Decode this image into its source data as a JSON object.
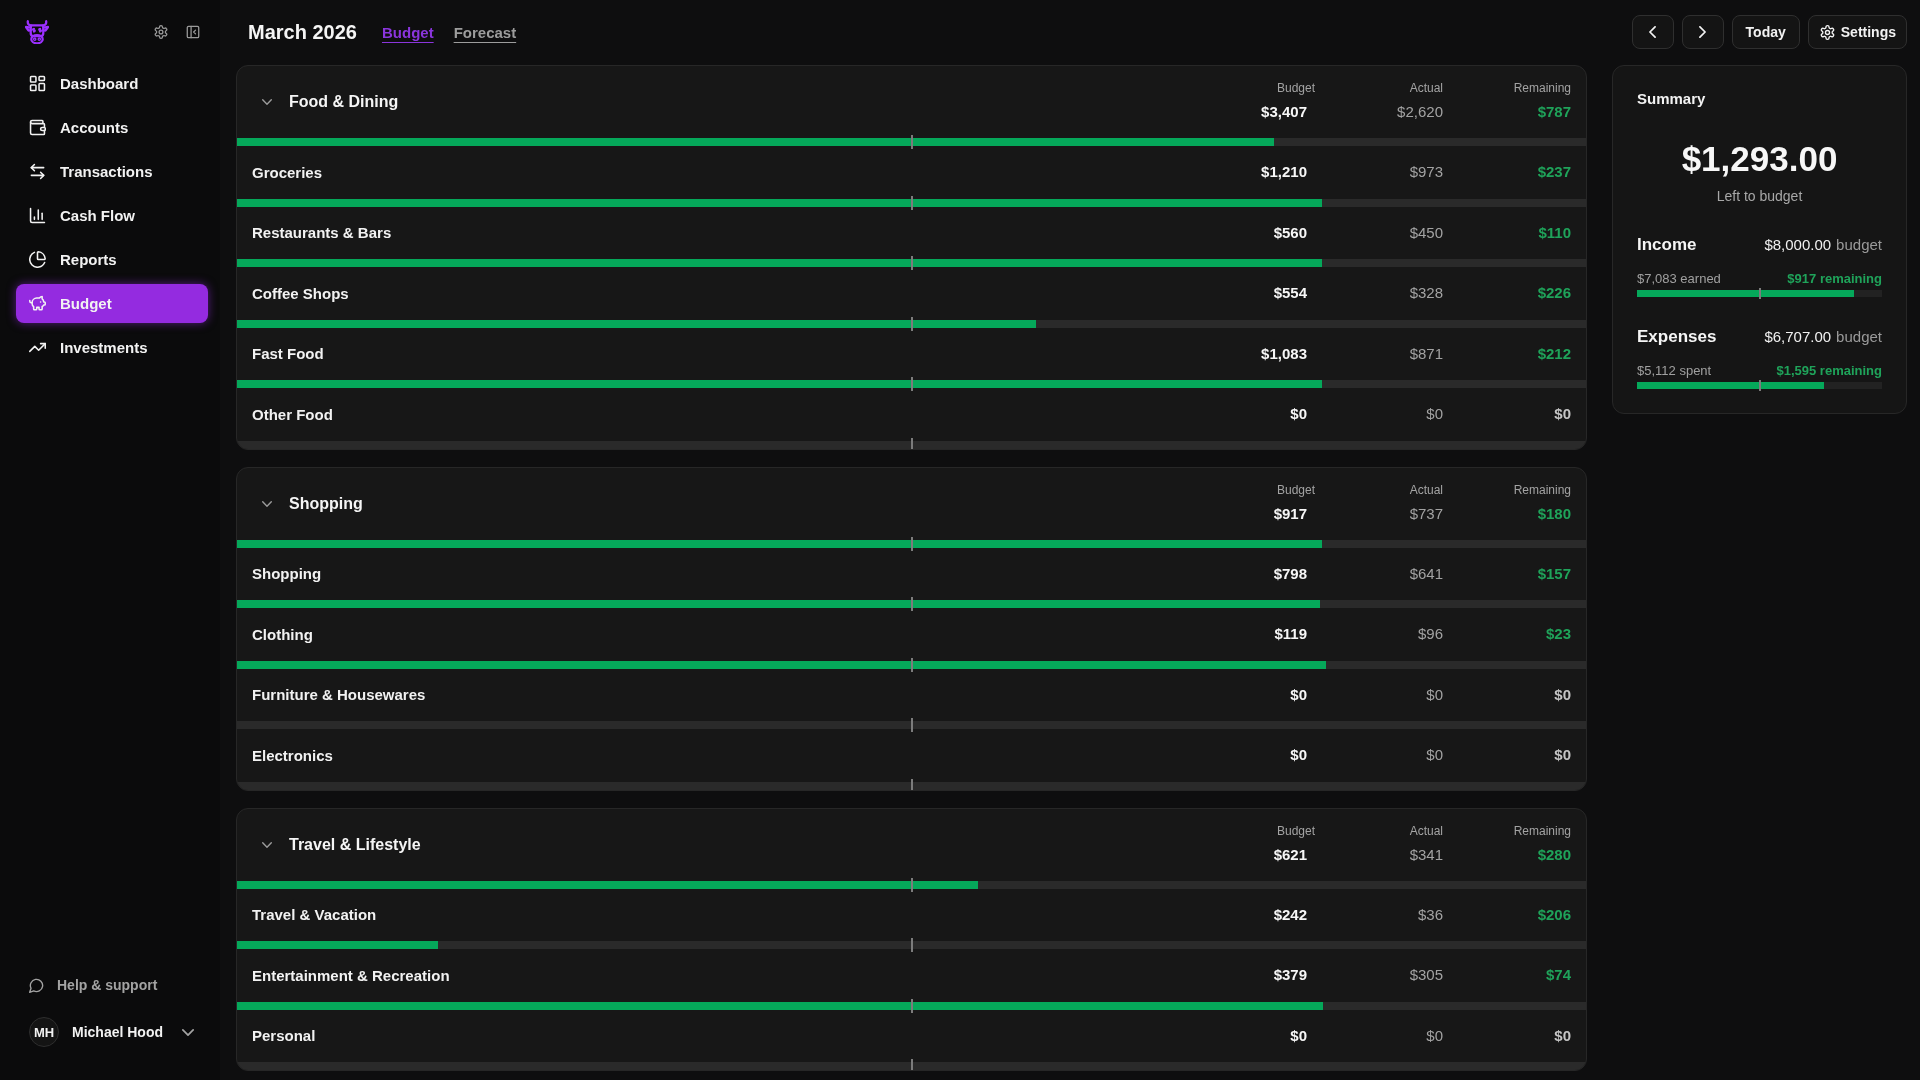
{
  "sidebar": {
    "nav": [
      {
        "label": "Dashboard",
        "selected": false
      },
      {
        "label": "Accounts",
        "selected": false
      },
      {
        "label": "Transactions",
        "selected": false
      },
      {
        "label": "Cash Flow",
        "selected": false
      },
      {
        "label": "Reports",
        "selected": false
      },
      {
        "label": "Budget",
        "selected": true
      },
      {
        "label": "Investments",
        "selected": false
      }
    ],
    "help": "Help & support",
    "user": {
      "initials": "MH",
      "name": "Michael Hood"
    }
  },
  "header": {
    "title": "March 2026",
    "tabs": [
      {
        "label": "Budget",
        "selected": true
      },
      {
        "label": "Forecast",
        "selected": false
      }
    ],
    "today_button": "Today",
    "settings_button": "Settings"
  },
  "groups": [
    {
      "title": "Food & Dining",
      "expanded": true,
      "column_headers": [
        "Budget",
        "Actual",
        "Remaining"
      ],
      "budget": "$3,407",
      "actual": "$2,620",
      "remaining": "$787",
      "positive": true,
      "level": 0.769,
      "items": [
        {
          "name": "Groceries",
          "budget": "$1,210",
          "actual": "$973",
          "remaining": "$237",
          "positive": true,
          "level": 0.804
        },
        {
          "name": "Restaurants & Bars",
          "budget": "$560",
          "actual": "$450",
          "remaining": "$110",
          "positive": true,
          "level": 0.804
        },
        {
          "name": "Coffee Shops",
          "budget": "$554",
          "actual": "$328",
          "remaining": "$226",
          "positive": true,
          "level": 0.592
        },
        {
          "name": "Fast Food",
          "budget": "$1,083",
          "actual": "$871",
          "remaining": "$212",
          "positive": true,
          "level": 0.804
        },
        {
          "name": "Other Food",
          "budget": "$0",
          "actual": "$0",
          "remaining": "$0",
          "positive": false,
          "level": 0
        }
      ]
    },
    {
      "title": "Shopping",
      "expanded": true,
      "column_headers": [
        "Budget",
        "Actual",
        "Remaining"
      ],
      "budget": "$917",
      "actual": "$737",
      "remaining": "$180",
      "positive": true,
      "level": 0.804,
      "items": [
        {
          "name": "Shopping",
          "budget": "$798",
          "actual": "$641",
          "remaining": "$157",
          "positive": true,
          "level": 0.803
        },
        {
          "name": "Clothing",
          "budget": "$119",
          "actual": "$96",
          "remaining": "$23",
          "positive": true,
          "level": 0.807
        },
        {
          "name": "Furniture & Housewares",
          "budget": "$0",
          "actual": "$0",
          "remaining": "$0",
          "positive": false,
          "level": 0
        },
        {
          "name": "Electronics",
          "budget": "$0",
          "actual": "$0",
          "remaining": "$0",
          "positive": false,
          "level": 0
        }
      ]
    },
    {
      "title": "Travel & Lifestyle",
      "expanded": true,
      "column_headers": [
        "Budget",
        "Actual",
        "Remaining"
      ],
      "budget": "$621",
      "actual": "$341",
      "remaining": "$280",
      "positive": true,
      "level": 0.549,
      "items": [
        {
          "name": "Travel & Vacation",
          "budget": "$242",
          "actual": "$36",
          "remaining": "$206",
          "positive": true,
          "level": 0.149
        },
        {
          "name": "Entertainment & Recreation",
          "budget": "$379",
          "actual": "$305",
          "remaining": "$74",
          "positive": true,
          "level": 0.805
        },
        {
          "name": "Personal",
          "budget": "$0",
          "actual": "$0",
          "remaining": "$0",
          "positive": false,
          "level": 0
        }
      ]
    }
  ],
  "summary": {
    "title": "Summary",
    "amount": "$1,293.00",
    "caption": "Left to budget",
    "sections": [
      {
        "label": "Income",
        "amount": "$8,000.00",
        "unit": "budget",
        "progress_text": "$7,083 earned",
        "remaining_text": "$917 remaining",
        "level": 0.885
      },
      {
        "label": "Expenses",
        "amount": "$6,707.00",
        "unit": "budget",
        "progress_text": "$5,112 spent",
        "remaining_text": "$1,595 remaining",
        "level": 0.762
      }
    ]
  }
}
